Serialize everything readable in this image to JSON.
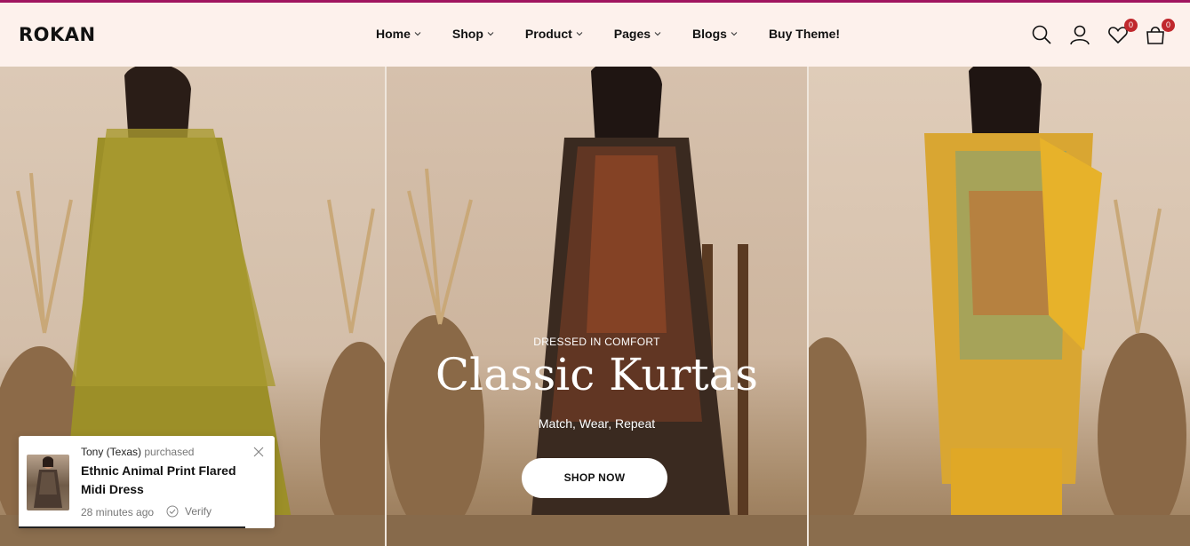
{
  "brand": {
    "logo_text": "ROKAN",
    "accent": "#a0155f"
  },
  "nav": {
    "items": [
      {
        "label": "Home",
        "has_dropdown": true
      },
      {
        "label": "Shop",
        "has_dropdown": true
      },
      {
        "label": "Product",
        "has_dropdown": true
      },
      {
        "label": "Pages",
        "has_dropdown": true
      },
      {
        "label": "Blogs",
        "has_dropdown": true
      },
      {
        "label": "Buy Theme!",
        "has_dropdown": false
      }
    ]
  },
  "header_icons": {
    "search": "search-icon",
    "account": "user-icon",
    "wishlist": {
      "icon": "heart-icon",
      "count": "0"
    },
    "cart": {
      "icon": "bag-icon",
      "count": "0"
    }
  },
  "hero": {
    "eyebrow": "DRESSED IN COMFORT",
    "headline": "Classic Kurtas",
    "subline": "Match, Wear, Repeat",
    "cta_label": "SHOP NOW"
  },
  "purchase_popup": {
    "customer": "Tony (Texas)",
    "action": "purchased",
    "product": "Ethnic Animal Print Flared Midi Dress",
    "time_ago": "28 minutes ago",
    "verify_label": "Verify"
  }
}
